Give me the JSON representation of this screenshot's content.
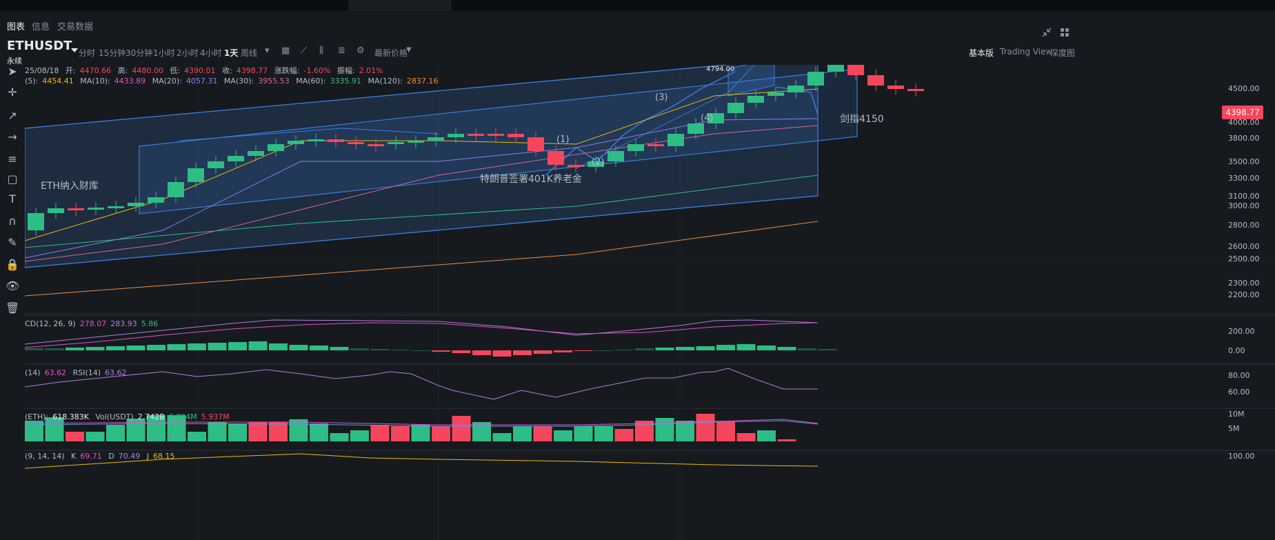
{
  "tabs": [
    "图表",
    "信息",
    "交易数据"
  ],
  "symbol": {
    "name": "ETHUSDT",
    "subtitle": "永续"
  },
  "timeframes": [
    "分时",
    "15分钟",
    "30分钟",
    "1小时",
    "2小时",
    "4小时",
    "1天",
    "周线"
  ],
  "active_timeframe": "1天",
  "price_type_label": "最新价格",
  "view_modes": [
    "基本版",
    "Trading View",
    "深度图"
  ],
  "active_view": "基本版",
  "ohlc": {
    "date": "25/08/18",
    "open_label": "开:",
    "open": "4470.66",
    "high_label": "高:",
    "high": "4480.00",
    "low_label": "低:",
    "low": "4390.01",
    "close_label": "收:",
    "close": "4398.77",
    "change_label": "涨跌幅:",
    "change": "-1.60%",
    "amp_label": "振幅:",
    "amp": "2.01%"
  },
  "ma": [
    {
      "label": "(5):",
      "value": "4454.41",
      "color": "#f0b90b"
    },
    {
      "label": "MA(10):",
      "value": "4433.89",
      "color": "#e052c6"
    },
    {
      "label": "MA(20):",
      "value": "4057.31",
      "color": "#8f7ef5"
    },
    {
      "label": "MA(30):",
      "value": "3955.53",
      "color": "#e0629a"
    },
    {
      "label": "MA(60):",
      "value": "3335.91",
      "color": "#2ebd85"
    },
    {
      "label": "MA(120):",
      "value": "2837.16",
      "color": "#f08a3c"
    }
  ],
  "price_axis": [
    "4500.00",
    "4000.00",
    "3800.00",
    "3500.00",
    "3300.00",
    "3100.00",
    "3000.00",
    "2800.00",
    "2600.00",
    "2500.00",
    "2300.00",
    "2200.00"
  ],
  "last_price": "4398.77",
  "peak_label": "4794.00",
  "annotations": {
    "target": "剑指4150",
    "treasury": "ETH纳入财库",
    "trump": "特朗普签署401K养老金",
    "wave1": "(1)",
    "wave2": "(2)",
    "wave3": "(3)",
    "wave4": "(4)"
  },
  "macd": {
    "label": "CD(12, 26, 9)",
    "v1": "278.07",
    "v2": "283.93",
    "v3": "5.86",
    "axis": [
      "200.00",
      "0.00"
    ]
  },
  "rsi": {
    "label1": "(14)",
    "v1": "63.62",
    "label2": "RSI(14)",
    "v2": "63.62",
    "axis": [
      "80.00",
      "60.00"
    ]
  },
  "vol": {
    "label": "(ETH):",
    "v1": "618.383K",
    "label2": "Vol(USDT)",
    "v2": "2.742B",
    "v3": "6.024M",
    "v4": "5.937M",
    "axis": [
      "10M",
      "5M"
    ]
  },
  "kdj": {
    "label": "(9, 14, 14)",
    "k_label": "K",
    "k": "69.71",
    "d_label": "D",
    "d": "70.49",
    "j_label": "J",
    "j": "68.15",
    "axis": [
      "100.00"
    ]
  },
  "colors": {
    "up": "#2ebd85",
    "down": "#f6465d",
    "channel": "#3b7dd8",
    "background": "#161a1e"
  }
}
